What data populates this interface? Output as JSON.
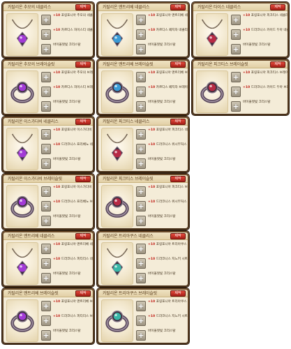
{
  "cards": [
    {
      "id": "c1",
      "title": "카탈리온 추모의 네클리스",
      "button": "제작",
      "gem": "#a23ad6",
      "slots": [
        {
          "qty": "+10",
          "text": "포링포니아 추모의 네클리스"
        },
        {
          "qty": "+10",
          "text": "카르디스 자이스티 네클리스"
        },
        {
          "qty": "",
          "text": "바이올렛빛 크리스탈"
        }
      ]
    },
    {
      "id": "c2",
      "title": "카탈리온 맨트리베 네클리스",
      "button": "제작",
      "gem": "#3a9bd6",
      "slots": [
        {
          "qty": "+10",
          "text": "포링포니아 맨트리베 네클리스"
        },
        {
          "qty": "+10",
          "text": "카르디스 페지자 네클리스"
        },
        {
          "qty": "",
          "text": "바이올렛빛 크리스탈"
        }
      ]
    },
    {
      "id": "c3",
      "title": "카탈리온 타이스 네클리스",
      "button": "제작",
      "gem": "#b72a45",
      "slots": [
        {
          "qty": "+10",
          "text": "포링포니아 피크티스 네클리스"
        },
        {
          "qty": "+10",
          "text": "드라코니스 카이드 두아 네클리스"
        },
        {
          "qty": "",
          "text": "바이올렛빛 크리스탈"
        }
      ]
    },
    {
      "id": "c4",
      "title": "카탈리온 추모의 브레이슬릿",
      "button": "제작",
      "gem": "#a23ad6",
      "slots": [
        {
          "qty": "+10",
          "text": "포링포니아 추모의 브레이슬릿"
        },
        {
          "qty": "+10",
          "text": "카르디스 자이스티 브레이슬릿"
        },
        {
          "qty": "",
          "text": "바이올렛빛 크리스탈"
        }
      ]
    },
    {
      "id": "c5",
      "title": "카탈리온 맨트리베 브레이슬릿",
      "button": "제작",
      "gem": "#3a9bd6",
      "slots": [
        {
          "qty": "+10",
          "text": "포링포니아 맨트리베 브레이슬릿"
        },
        {
          "qty": "+10",
          "text": "카르디스 페지자 브레이슬릿"
        },
        {
          "qty": "",
          "text": "바이올렛빛 크리스탈"
        }
      ]
    },
    {
      "id": "c6",
      "title": "카탈리온 피크티스 브레이슬릿",
      "button": "제작",
      "gem": "#b72a45",
      "slots": [
        {
          "qty": "+10",
          "text": "포링포니아 피크티스 브레이슬릿"
        },
        {
          "qty": "+10",
          "text": "드라코니스 카이드 두아 브레이슬릿"
        },
        {
          "qty": "",
          "text": "바이올렛빛 크리스탈"
        }
      ]
    },
    {
      "id": "c7",
      "title": "카탈리온 이스가다비 네클리스",
      "button": "제작",
      "gem": "#a23ad6",
      "slots": [
        {
          "qty": "+10",
          "text": "포링포니아 이스가다비 네클리스"
        },
        {
          "qty": "+10",
          "text": "드라코니스 프리베노 네클리스"
        },
        {
          "qty": "",
          "text": "바이올렛빛 크리스탈"
        }
      ]
    },
    {
      "id": "c8",
      "title": "카탈리온 피크티스 네클리스",
      "button": "제작",
      "gem": "#b72a45",
      "slots": [
        {
          "qty": "+10",
          "text": "포링포니아 피크티스 네클리스"
        },
        {
          "qty": "+10",
          "text": "드라코니스 위시부처스 네클리스"
        },
        {
          "qty": "",
          "text": "바이올렛빛 크리스탈"
        }
      ]
    },
    {
      "id": "c9",
      "title": "카탈리온 이스가다비 브레이슬릿",
      "button": "제작",
      "gem": "#a23ad6",
      "slots": [
        {
          "qty": "+10",
          "text": "포링포니아 이스가다비 브레이슬릿"
        },
        {
          "qty": "+10",
          "text": "드라코니스 프리베노 브레이슬릿"
        },
        {
          "qty": "",
          "text": "바이올렛빛 크리스탈"
        }
      ]
    },
    {
      "id": "c10",
      "title": "카탈리온 피크티스 브레이슬릿",
      "button": "제작",
      "gem": "#b72a45",
      "slots": [
        {
          "qty": "+10",
          "text": "포링포니아 피크티스 브레이슬릿"
        },
        {
          "qty": "+10",
          "text": "드라코니스 위시부처스 브레이슬릿"
        },
        {
          "qty": "",
          "text": "바이올렛빛 크리스탈"
        }
      ]
    },
    {
      "id": "c11",
      "title": "카탈리온 맨트리베 네클리스",
      "button": "제작",
      "gem": "#a23ad6",
      "slots": [
        {
          "qty": "+10",
          "text": "포링포니아 맨트리베 네클리스"
        },
        {
          "qty": "+10",
          "text": "드라코니스 피티리스 네클리스"
        },
        {
          "qty": "",
          "text": "바이올렛빛 크리스탈"
        }
      ]
    },
    {
      "id": "c12",
      "title": "카탈리온 트리아쿠스 네클리스",
      "button": "제작",
      "gem": "#3ab7a8",
      "slots": [
        {
          "qty": "+10",
          "text": "포링포니아 트리아쿠스 네클리스"
        },
        {
          "qty": "+10",
          "text": "드라코니스 지느키 시트 네클리스"
        },
        {
          "qty": "",
          "text": "바이올렛빛 크리스탈"
        }
      ]
    },
    {
      "id": "c13",
      "title": "카탈리온 맨트리베 브레이슬릿",
      "button": "제작",
      "gem": "#a23ad6",
      "slots": [
        {
          "qty": "+10",
          "text": "포링포니아 맨트리베 브레이슬릿"
        },
        {
          "qty": "+10",
          "text": "드라코니스 피티리스 브레이슬릿"
        },
        {
          "qty": "",
          "text": "바이올렛빛 크리스탈"
        }
      ]
    },
    {
      "id": "c14",
      "title": "카탈리온 트리아쿠스 브레이슬릿",
      "button": "제작",
      "gem": "#3ab7a8",
      "slots": [
        {
          "qty": "+10",
          "text": "포링포니아 트리아쿠스 브레이슬릿"
        },
        {
          "qty": "+10",
          "text": "드라코니스 지느키 시트 브레이슬릿"
        },
        {
          "qty": "",
          "text": "바이올렛빛 크리스탈"
        }
      ]
    }
  ]
}
